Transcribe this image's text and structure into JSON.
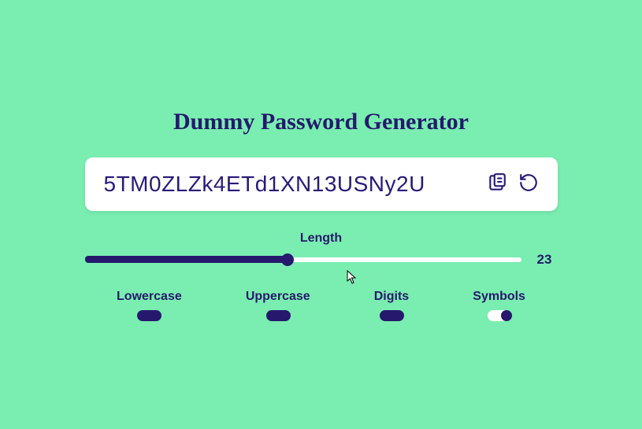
{
  "title": "Dummy Password Generator",
  "password": "5TM0ZLZk4ETd1XN13USNy2U",
  "length": {
    "label": "Length",
    "value": "23"
  },
  "toggles": {
    "lowercase": {
      "label": "Lowercase",
      "on": true
    },
    "uppercase": {
      "label": "Uppercase",
      "on": true
    },
    "digits": {
      "label": "Digits",
      "on": true
    },
    "symbols": {
      "label": "Symbols",
      "on": false
    }
  }
}
